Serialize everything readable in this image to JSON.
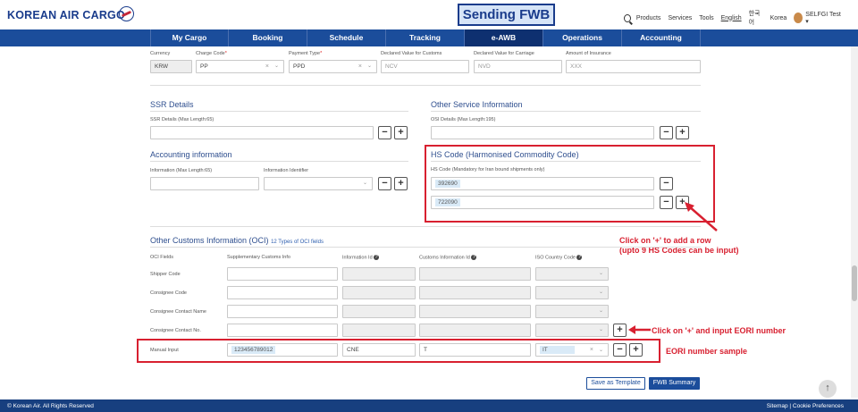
{
  "header": {
    "logo": "KOREAN AIR CARGO",
    "title": "Sending FWB",
    "links": [
      "Products",
      "Services",
      "Tools",
      "English",
      "한국어",
      "Korea"
    ],
    "user": "SELFGI Test"
  },
  "nav": [
    "My Cargo",
    "Booking",
    "Schedule",
    "Tracking",
    "e-AWB",
    "Operations",
    "Accounting"
  ],
  "charges": {
    "currency_label": "Currency",
    "currency": "KRW",
    "charge_code_label": "Charge Code",
    "charge_code": "PP",
    "payment_label": "Payment Type",
    "payment": "PPD",
    "dvc_customs_label": "Declared Value for Customs",
    "dvc_customs_ph": "NCV",
    "dvc_carriage_label": "Declared Value for Carriage",
    "dvc_carriage_ph": "NVD",
    "insurance_label": "Amount of Insurance",
    "insurance_ph": "XXX"
  },
  "ssr": {
    "title": "SSR Details",
    "label": "SSR Details (Max Length:65)"
  },
  "osi": {
    "title": "Other Service Information",
    "label": "OSI Details (Max Length:195)"
  },
  "acct": {
    "title": "Accounting information",
    "info_label": "Information (Max Length:65)",
    "id_label": "Information Identifier"
  },
  "hs": {
    "title": "HS Code (Harmonised Commodity Code)",
    "label": "HS Code (Mandatory for Iran bound shipments only)",
    "codes": [
      "392690",
      "722090"
    ]
  },
  "oci": {
    "title": "Other Customs Information (OCI)",
    "count": "12 Types of OCI fields",
    "col_fields": "OCI Fields",
    "col_supp": "Supplementary Customs Info",
    "col_info_id": "Information Id",
    "col_customs_id": "Customs Information Id",
    "col_iso": "ISO Country Code",
    "rows": [
      "Shipper Code",
      "Consignee Code",
      "Consignee Contact Name",
      "Consignee Contact No."
    ],
    "manual_label": "Manual Input",
    "manual_supp": "123456789012",
    "manual_info_id": "CNE",
    "manual_customs_id": "T",
    "manual_iso": "IT"
  },
  "annotations": {
    "add_row": "Click on '+' to add a row",
    "add_row_2": "(upto 9 HS Codes can be input)",
    "eori_add": "Click on '+' and input EORI number",
    "eori_sample": "EORI number sample"
  },
  "buttons": {
    "save_template": "Save as Template",
    "fwb_summary": "FWB Summary"
  },
  "footer": {
    "copyright": "© Korean Air. All Rights Reserved",
    "links": "Sitemap | Cookie Preferences"
  },
  "colors": {
    "nav": "#1b4d9b",
    "accent": "#d82030",
    "footer": "#173f7f"
  }
}
